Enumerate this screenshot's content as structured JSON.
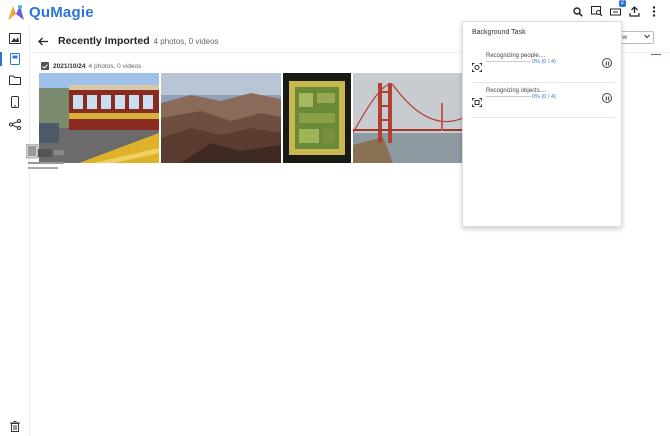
{
  "app": {
    "name": "QuMagie",
    "colors": {
      "brand": "#2d74d8"
    }
  },
  "topbar": {
    "icons": [
      "search-icon",
      "image-search-icon",
      "tasks-icon",
      "upload-icon",
      "more-vert-icon"
    ],
    "task_badge": "2"
  },
  "sidebar": {
    "items": [
      {
        "name": "photos",
        "icon": "image-icon"
      },
      {
        "name": "recently-imported",
        "icon": "document-icon",
        "active": true
      },
      {
        "name": "folders",
        "icon": "folder-icon"
      },
      {
        "name": "mobile",
        "icon": "phone-icon"
      },
      {
        "name": "share",
        "icon": "share-icon"
      },
      {
        "name": "trash",
        "icon": "trash-icon"
      }
    ]
  },
  "header": {
    "title": "Recently Imported",
    "subtitle": "4 photos, 0 videos",
    "view_dropdown": "iew"
  },
  "group": {
    "date": "2021/10/24",
    "count": "4 photos, 0 videos"
  },
  "photos": [
    {
      "desc": "cable-car"
    },
    {
      "desc": "canyon"
    },
    {
      "desc": "chip"
    },
    {
      "desc": "bridge"
    }
  ],
  "background_task": {
    "title": "Background Task",
    "tasks": [
      {
        "name": "Recognizing people....",
        "progress": "0% (0 / 4)"
      },
      {
        "name": "Recognizing objects....",
        "progress": "0% (0 / 4)"
      }
    ]
  }
}
